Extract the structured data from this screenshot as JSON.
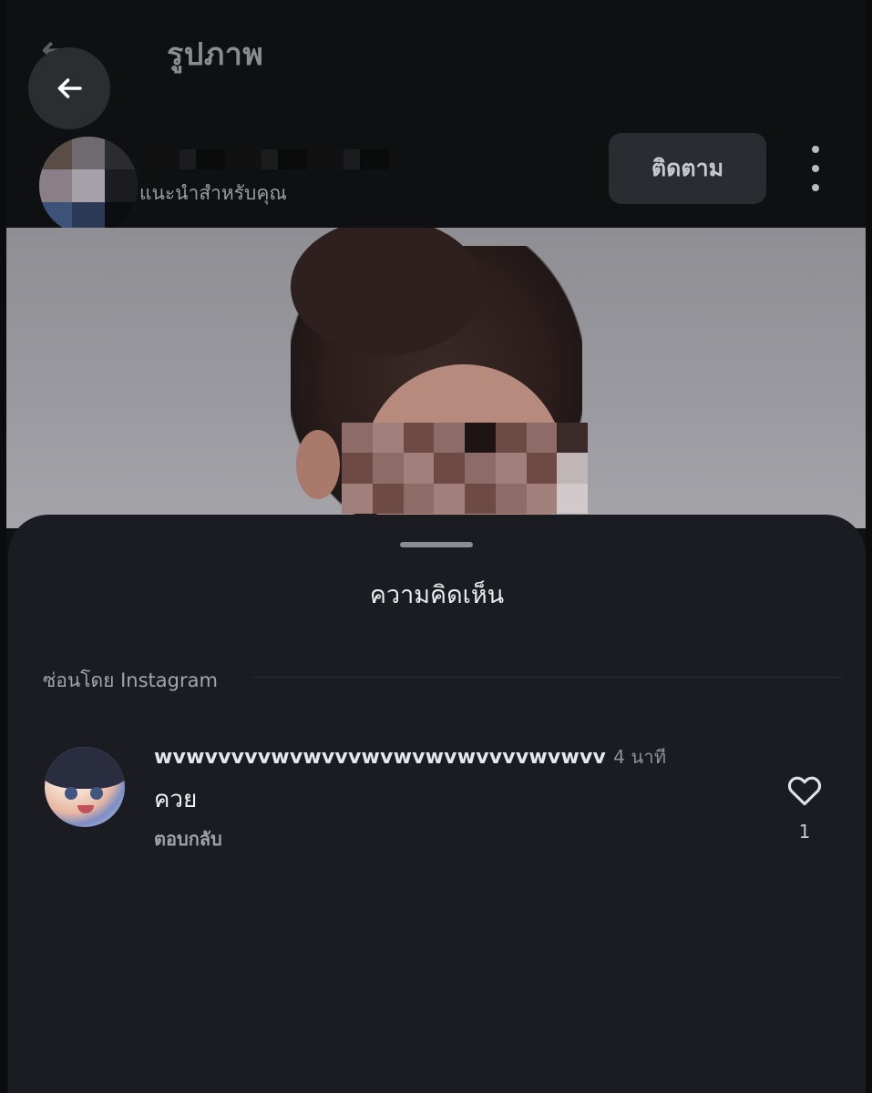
{
  "header": {
    "title": "รูปภาพ",
    "back_icon": "arrow-left-icon"
  },
  "profile": {
    "suggestion_label": "แนะนำสำหรับคุณ",
    "follow_label": "ติดตาม",
    "more_icon": "more-vertical-icon"
  },
  "comments_sheet": {
    "title": "ความคิดเห็น",
    "hidden_by_label": "ซ่อนโดย Instagram",
    "comments": [
      {
        "username": "wvwvvvvvwvwvvvwvwvwvwvvvvwvwvv",
        "time": "4 นาที",
        "text": "ควย",
        "reply_label": "ตอบกลับ",
        "like_count": "1",
        "like_icon": "heart-icon"
      }
    ]
  },
  "colors": {
    "background": "#0f1012",
    "sheet": "#1a1c22",
    "button": "#2a2c31"
  }
}
